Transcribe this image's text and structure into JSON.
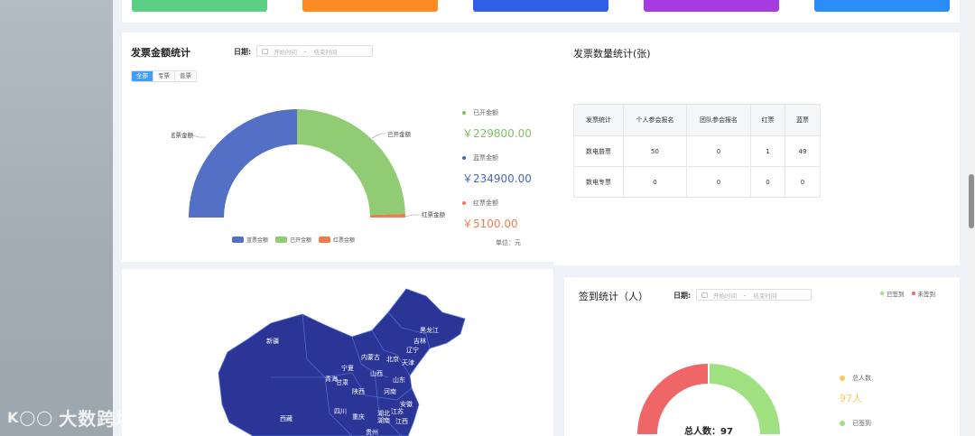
{
  "colors": {
    "green": "#91cc75",
    "blue": "#5470c6",
    "orange": "#ee7d4b",
    "map": "#2b3595",
    "red": "#ee6666",
    "lightgreen": "#9fe080",
    "yellow": "#fac858"
  },
  "top_cards": [
    {
      "color": "#5dcf85"
    },
    {
      "color": "#ff8a24"
    },
    {
      "color": "#2f5fe6"
    },
    {
      "color": "#a63be0"
    },
    {
      "color": "#2a8cf5"
    }
  ],
  "amount_panel": {
    "title": "发票金额统计",
    "date_label": "日期:",
    "start_placeholder": "开始时间",
    "end_placeholder": "结束时间",
    "tabs": [
      "全部",
      "专票",
      "普票"
    ],
    "active_tab": 0,
    "slice_labels": {
      "blue": "蓝票金额",
      "green": "已开金额",
      "orange": "红票金额"
    },
    "legend": [
      "蓝票金额",
      "已开金额",
      "红票金额"
    ],
    "stats": [
      {
        "label": "已开金额",
        "value": "￥229800.00",
        "color": "#7cc166"
      },
      {
        "label": "蓝票金额",
        "value": "￥234900.00",
        "color": "#4a66b8"
      },
      {
        "label": "红票金额",
        "value": "￥5100.00",
        "color": "#ee7d4b"
      }
    ],
    "unit": "单位：元"
  },
  "chart_data": {
    "type": "pie",
    "categories": [
      "蓝票金额",
      "已开金额",
      "红票金额"
    ],
    "values": [
      234900,
      229800,
      5100
    ],
    "legend_position": "bottom"
  },
  "qty_panel": {
    "title": "发票数量统计(张)",
    "headers": [
      "发票统计",
      "个人参会报名",
      "团队参会报名",
      "红票",
      "蓝票"
    ],
    "rows": [
      [
        "数电普票",
        "50",
        "0",
        "1",
        "49"
      ],
      [
        "数电专票",
        "0",
        "0",
        "0",
        "0"
      ]
    ]
  },
  "map_labels": [
    "黑龙江",
    "吉林",
    "辽宁",
    "内蒙古",
    "北京",
    "新疆",
    "宁夏",
    "山西",
    "青海",
    "甘肃",
    "陕西",
    "河南",
    "山东",
    "西藏",
    "四川",
    "重庆",
    "湖北",
    "安徽",
    "江苏",
    "湖南",
    "江西",
    "贵州",
    "天津"
  ],
  "signin_panel": {
    "title": "签到统计（人）",
    "date_label": "日期:",
    "start_placeholder": "开始时间",
    "end_placeholder": "结束时间",
    "legend": [
      "已签到",
      "未签到"
    ],
    "total_label": "总人数",
    "total_value": "97人",
    "signed_label": "已签到",
    "center_text": "总人数：97"
  },
  "watermark": "大数跨境"
}
